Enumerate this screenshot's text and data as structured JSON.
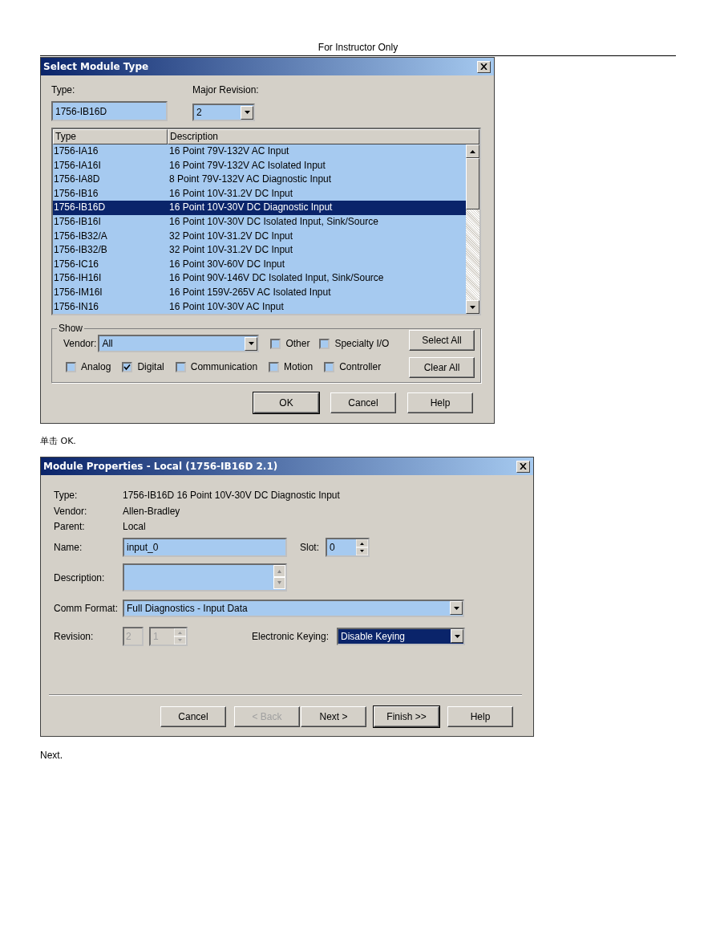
{
  "header": "For Instructor Only",
  "select_dialog": {
    "title": "Select Module Type",
    "type_label": "Type:",
    "type_value": "1756-IB16D",
    "major_revision_label": "Major Revision:",
    "major_revision_value": "2",
    "columns": [
      "Type",
      "Description"
    ],
    "rows": [
      {
        "type": "1756-IA16",
        "description": "16 Point 79V-132V AC Input",
        "selected": false
      },
      {
        "type": "1756-IA16I",
        "description": "16 Point 79V-132V AC Isolated Input",
        "selected": false
      },
      {
        "type": "1756-IA8D",
        "description": "8 Point 79V-132V AC Diagnostic Input",
        "selected": false
      },
      {
        "type": "1756-IB16",
        "description": "16 Point 10V-31.2V DC Input",
        "selected": false
      },
      {
        "type": "1756-IB16D",
        "description": "16 Point 10V-30V DC Diagnostic Input",
        "selected": true
      },
      {
        "type": "1756-IB16I",
        "description": "16 Point 10V-30V DC Isolated Input, Sink/Source",
        "selected": false
      },
      {
        "type": "1756-IB32/A",
        "description": "32 Point 10V-31.2V DC Input",
        "selected": false
      },
      {
        "type": "1756-IB32/B",
        "description": "32 Point 10V-31.2V DC Input",
        "selected": false
      },
      {
        "type": "1756-IC16",
        "description": "16 Point 30V-60V DC Input",
        "selected": false
      },
      {
        "type": "1756-IH16I",
        "description": "16 Point 90V-146V DC Isolated Input, Sink/Source",
        "selected": false
      },
      {
        "type": "1756-IM16I",
        "description": "16 Point 159V-265V AC Isolated Input",
        "selected": false
      },
      {
        "type": "1756-IN16",
        "description": "16 Point 10V-30V AC Input",
        "selected": false
      }
    ],
    "show": {
      "label": "Show",
      "vendor_label": "Vendor:",
      "vendor_value": "All",
      "top_checkboxes": [
        {
          "label": "Other",
          "checked": false
        },
        {
          "label": "Specialty I/O",
          "checked": false
        }
      ],
      "bottom_checkboxes": [
        {
          "label": "Analog",
          "checked": false
        },
        {
          "label": "Digital",
          "checked": true
        },
        {
          "label": "Communication",
          "checked": false
        },
        {
          "label": "Motion",
          "checked": false
        },
        {
          "label": "Controller",
          "checked": false
        }
      ],
      "buttons": [
        "Select All",
        "Clear All"
      ]
    },
    "buttons": [
      {
        "label": "OK",
        "default": true,
        "disabled": false
      },
      {
        "label": "Cancel",
        "default": false,
        "disabled": false
      },
      {
        "label": "Help",
        "default": false,
        "disabled": false
      }
    ]
  },
  "caption_1": "单击 OK.",
  "properties_dialog": {
    "title": "Module Properties - Local (1756-IB16D 2.1)",
    "info": [
      {
        "label": "Type:",
        "value": "1756-IB16D 16 Point 10V-30V DC Diagnostic Input"
      },
      {
        "label": "Vendor:",
        "value": "Allen-Bradley"
      },
      {
        "label": "Parent:",
        "value": "Local"
      }
    ],
    "name_label": "Name:",
    "name_value": "input_0",
    "slot_label": "Slot:",
    "slot_value": "0",
    "description_label": "Description:",
    "comm_format_label": "Comm Format:",
    "comm_format_value": "Full Diagnostics - Input Data",
    "revision": {
      "label": "Revision:",
      "major": "2",
      "minor": "1",
      "disabled": true
    },
    "keying": {
      "label": "Electronic Keying:",
      "value": "Disable Keying",
      "selected": true
    },
    "buttons": [
      {
        "label": "Cancel",
        "default": false,
        "disabled": false
      },
      {
        "label": "< Back",
        "default": false,
        "disabled": true
      },
      {
        "label": "Next >",
        "default": false,
        "disabled": false
      },
      {
        "label": "Finish >>",
        "default": true,
        "disabled": false
      },
      {
        "label": "Help",
        "default": false,
        "disabled": false
      }
    ]
  },
  "caption_2": "Next."
}
